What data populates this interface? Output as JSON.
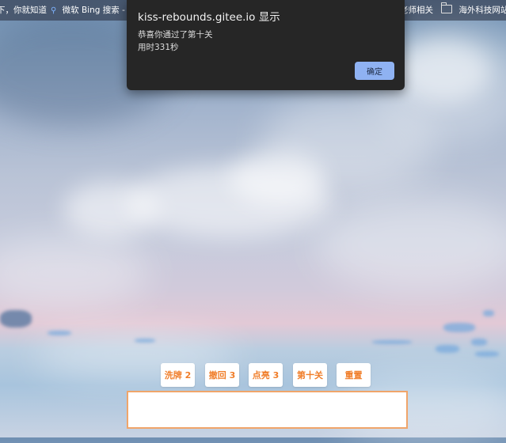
{
  "browser": {
    "bookmarks": [
      {
        "label": "下，你就知道",
        "icon": "none"
      },
      {
        "label": "微软 Bing 搜索 - 国",
        "icon": "search-icon"
      },
      {
        "label": "老师相关",
        "icon": "none"
      },
      {
        "label": "海外科技网站",
        "icon": "folder-icon"
      }
    ]
  },
  "dialog": {
    "title": "kiss-rebounds.gitee.io 显示",
    "message_line1": "恭喜你通过了第十关",
    "message_line2": "用时331秒",
    "ok_label": "确定"
  },
  "game": {
    "buttons": [
      {
        "label": "洗牌 2"
      },
      {
        "label": "撤回 3"
      },
      {
        "label": "点亮 3"
      },
      {
        "label": "第十关"
      },
      {
        "label": "重置"
      }
    ],
    "accent_color": "#f07e2a",
    "tray_border_color": "#f0a56a"
  }
}
